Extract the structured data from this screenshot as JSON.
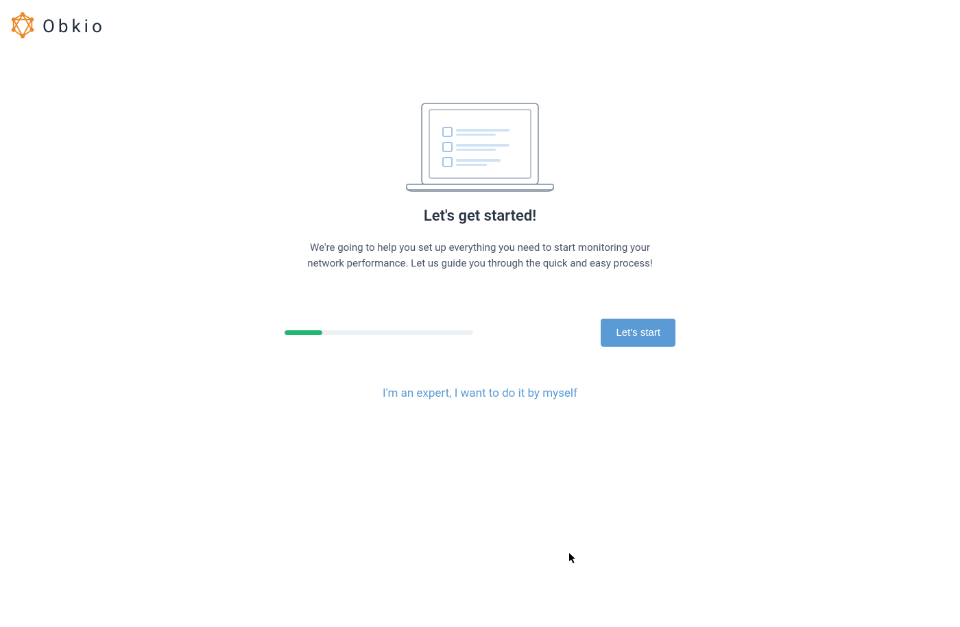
{
  "brand": {
    "name": "Obkio"
  },
  "main": {
    "heading": "Let's get started!",
    "description": "We're going to help you set up everything you need to start monitoring your network performance. Let us guide you through the quick and easy process!",
    "start_button_label": "Let's start",
    "expert_link_label": "I'm an expert, I want to do it by myself",
    "progress_percent": "20"
  },
  "colors": {
    "accent_orange": "#e88a2a",
    "accent_blue": "#5b9bd5",
    "progress_green": "#22b770",
    "text_dark": "#2a3546"
  }
}
